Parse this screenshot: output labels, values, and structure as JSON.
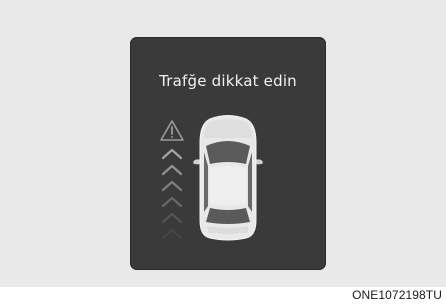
{
  "display": {
    "warning_text": "Trafğe dikkat edin"
  },
  "caption": {
    "image_code": "ONE1072198TU"
  },
  "icons": {
    "warning": "warning-triangle-icon",
    "approach": "approaching-chevrons-icon",
    "vehicle": "car-top-view-icon"
  },
  "colors": {
    "panel": "#3a3a3a",
    "background": "#e9e9e9",
    "text": "#f2f2f2"
  }
}
